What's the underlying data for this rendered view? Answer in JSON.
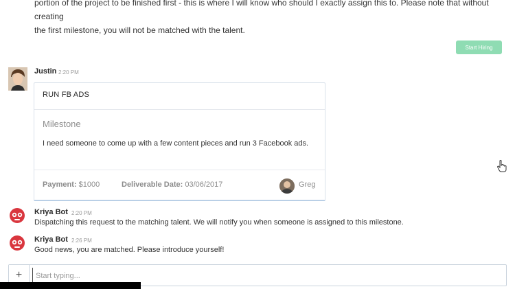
{
  "intro": {
    "line1": "portion of the project to be finished first - this is where I will know who should I exactly assign this to. Please note that without creating",
    "line2": "the first milestone, you will not be matched with the talent."
  },
  "start_hiring_label": "Start Hiring",
  "messages": [
    {
      "author": "Justin",
      "time": "2:20 PM"
    },
    {
      "author": "Kriya Bot",
      "time": "2:20 PM",
      "text": "Dispatching this request to the matching talent. We will notify you when someone is assigned to this milestone."
    },
    {
      "author": "Kriya Bot",
      "time": "2:26 PM",
      "text": "Good news, you are matched. Please introduce yourself!"
    }
  ],
  "card": {
    "title": "RUN FB ADS",
    "type": "Milestone",
    "description": "I need someone to come up with a few content pieces and run 3 Facebook ads.",
    "payment_label": "Payment:",
    "payment_value": "$1000",
    "deliverable_label": "Deliverable Date:",
    "deliverable_value": "03/06/2017",
    "assignee": "Greg"
  },
  "composer": {
    "plus_label": "+",
    "placeholder": "Start typing..."
  },
  "colors": {
    "start_hiring_bg": "#8fdcb3",
    "bot_red": "#d9363e",
    "card_border": "#b9cfe6"
  },
  "icons": {
    "bot_avatar": "robot-icon",
    "cursor": "hand-cursor-icon"
  }
}
